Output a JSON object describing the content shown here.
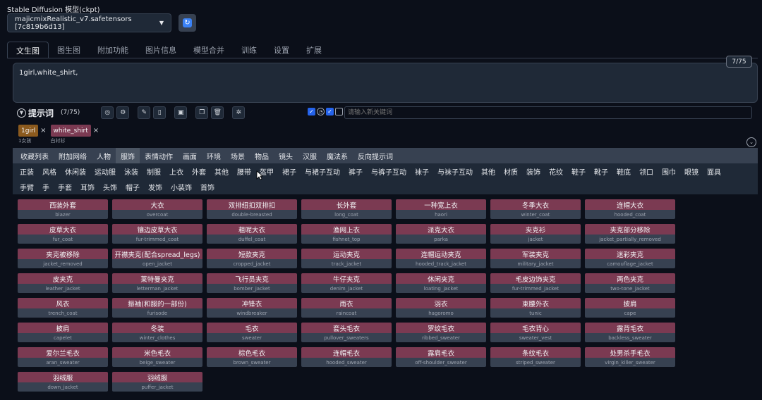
{
  "model": {
    "label": "Stable Diffusion 模型(ckpt)",
    "selected": "majicmixRealistic_v7.safetensors [7c819b6d13]",
    "refresh_icon": "refresh-icon"
  },
  "tabs": [
    {
      "label": "文生图",
      "active": true
    },
    {
      "label": "图生图"
    },
    {
      "label": "附加功能"
    },
    {
      "label": "图片信息"
    },
    {
      "label": "模型合并"
    },
    {
      "label": "训练"
    },
    {
      "label": "设置"
    },
    {
      "label": "扩展"
    }
  ],
  "prompt": {
    "text": "1girl,white_shirt,",
    "token_count": "7/75"
  },
  "toolbar": {
    "title": "提示词",
    "count": "(7/75)",
    "keyword_placeholder": "请输入新关键词"
  },
  "chips": [
    {
      "tag": "1girl",
      "sub": "1女孩",
      "color": "#8b5a1e"
    },
    {
      "tag": "white_shirt",
      "sub": "白衬衫",
      "color": "#7b3a52"
    }
  ],
  "categories": [
    "收藏列表",
    "附加网络",
    "人物",
    "服饰",
    "表情动作",
    "画面",
    "环境",
    "场景",
    "物品",
    "镜头",
    "汉服",
    "魔法系",
    "反向提示词"
  ],
  "active_category": "服饰",
  "subcategories_row1": [
    "正装",
    "风格",
    "休闲装",
    "运动服",
    "泳装",
    "制服",
    "上衣",
    "外套",
    "其他",
    "腰带",
    "盔甲",
    "裙子",
    "与裙子互动",
    "裤子",
    "与裤子互动",
    "袜子",
    "与袜子互动",
    "其他",
    "材质",
    "装饰",
    "花纹",
    "鞋子",
    "靴子",
    "鞋底",
    "领口",
    "围巾",
    "眼镜",
    "面具"
  ],
  "subcategories_row2": [
    "手臂",
    "手",
    "手套",
    "耳饰",
    "头饰",
    "帽子",
    "发饰",
    "小装饰",
    "首饰"
  ],
  "active_sub": "外套",
  "tags": [
    {
      "zh": "西装外套",
      "en": "blazer"
    },
    {
      "zh": "大衣",
      "en": "overcoat"
    },
    {
      "zh": "双排纽扣双排扣",
      "en": "double-breasted"
    },
    {
      "zh": "长外套",
      "en": "long_coat"
    },
    {
      "zh": "一种宽上衣",
      "en": "haori"
    },
    {
      "zh": "冬季大衣",
      "en": "winter_coat"
    },
    {
      "zh": "连帽大衣",
      "en": "hooded_coat"
    },
    {
      "zh": "皮草大衣",
      "en": "fur_coat"
    },
    {
      "zh": "镶边皮草大衣",
      "en": "fur-trimmed_coat"
    },
    {
      "zh": "粗呢大衣",
      "en": "duffel_coat"
    },
    {
      "zh": "渔网上衣",
      "en": "fishnet_top"
    },
    {
      "zh": "派克大衣",
      "en": "parka"
    },
    {
      "zh": "夹克衫",
      "en": "jacket"
    },
    {
      "zh": "夹克部分移除",
      "en": "jacket_partially_removed"
    },
    {
      "zh": "夹克被移除",
      "en": "jacket_removed"
    },
    {
      "zh": "开襟夹克(配合spread_legs)",
      "en": "open_jacket"
    },
    {
      "zh": "短款夹克",
      "en": "cropped_jacket"
    },
    {
      "zh": "运动夹克",
      "en": "track_jacket"
    },
    {
      "zh": "连帽运动夹克",
      "en": "hooded_track_jacket"
    },
    {
      "zh": "军装夹克",
      "en": "military_jacket"
    },
    {
      "zh": "迷彩夹克",
      "en": "camouflage_jacket"
    },
    {
      "zh": "皮夹克",
      "en": "leather_jacket"
    },
    {
      "zh": "莱特曼夹克",
      "en": "letterman_jacket"
    },
    {
      "zh": "飞行员夹克",
      "en": "bomber_jacket"
    },
    {
      "zh": "牛仔夹克",
      "en": "denim_jacket"
    },
    {
      "zh": "休闲夹克",
      "en": "loating_jacket"
    },
    {
      "zh": "毛皮边饰夹克",
      "en": "fur-trimmed_jacket"
    },
    {
      "zh": "两色夹克",
      "en": "two-tone_jacket"
    },
    {
      "zh": "风衣",
      "en": "trench_coat"
    },
    {
      "zh": "振袖(和服的一部份)",
      "en": "furisode"
    },
    {
      "zh": "冲锋衣",
      "en": "windbreaker"
    },
    {
      "zh": "雨衣",
      "en": "raincoat"
    },
    {
      "zh": "羽衣",
      "en": "hagoromo"
    },
    {
      "zh": "束腰外衣",
      "en": "tunic"
    },
    {
      "zh": "披肩",
      "en": "cape"
    },
    {
      "zh": "披肩",
      "en": "capelet"
    },
    {
      "zh": "冬装",
      "en": "winter_clothes"
    },
    {
      "zh": "毛衣",
      "en": "sweater"
    },
    {
      "zh": "套头毛衣",
      "en": "pullover_sweaters"
    },
    {
      "zh": "罗纹毛衣",
      "en": "ribbed_sweater"
    },
    {
      "zh": "毛衣背心",
      "en": "sweater_vest"
    },
    {
      "zh": "露背毛衣",
      "en": "backless_sweater"
    },
    {
      "zh": "爱尔兰毛衣",
      "en": "aran_sweater"
    },
    {
      "zh": "米色毛衣",
      "en": "beige_sweater"
    },
    {
      "zh": "棕色毛衣",
      "en": "brown_sweater"
    },
    {
      "zh": "连帽毛衣",
      "en": "hooded_sweater"
    },
    {
      "zh": "露肩毛衣",
      "en": "off-shoulder_sweater"
    },
    {
      "zh": "条纹毛衣",
      "en": "striped_sweater"
    },
    {
      "zh": "处男杀手毛衣",
      "en": "virgin_killer_sweater"
    },
    {
      "zh": "羽绒服",
      "en": "down_jacket"
    },
    {
      "zh": "羽绒服",
      "en": "puffer_jacket"
    }
  ]
}
